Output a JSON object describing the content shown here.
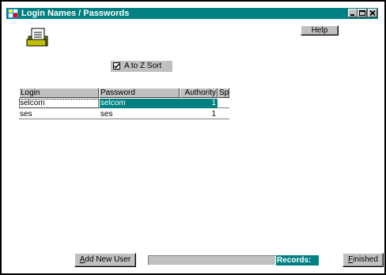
{
  "window": {
    "title": "Login Names / Passwords",
    "title_bar_color": "#008080",
    "controls": [
      "minimize-icon",
      "maximize-icon",
      "close-icon"
    ]
  },
  "toolbar": {
    "icon": "document-icon",
    "help_label": "Help"
  },
  "sort": {
    "label": "A to Z  Sort",
    "checked": true
  },
  "table": {
    "columns": [
      "Login",
      "Password",
      "Authority",
      "Sp"
    ],
    "rows": [
      {
        "login": "selcom",
        "password": "selcom",
        "authority": "1"
      },
      {
        "login": "ses",
        "password": "ses",
        "authority": "1"
      }
    ],
    "selected_row": 0,
    "selection_color": "#008080"
  },
  "footer": {
    "add_user": {
      "mnemonic": "A",
      "rest": "dd New User"
    },
    "records_label": "Records:",
    "finished": {
      "mnemonic": "F",
      "rest": "inished"
    }
  }
}
